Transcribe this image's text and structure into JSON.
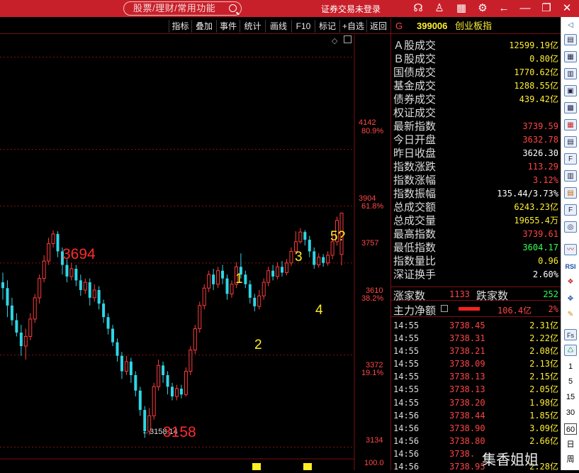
{
  "titlebar": {
    "search_placeholder": "股票/理财/常用功能",
    "login_status": "证券交易未登录",
    "icons": [
      "support-icon",
      "shirt-icon",
      "grid-icon",
      "settings-icon",
      "back-icon",
      "minimize-icon",
      "restore-icon",
      "close-icon"
    ]
  },
  "toolbar": {
    "items": [
      "指标",
      "叠加",
      "事件",
      "统计",
      "画线",
      "F10",
      "标记",
      "+自选",
      "返回"
    ]
  },
  "chart": {
    "price_ticks": [
      {
        "price": "4142",
        "pct": "80.9%"
      },
      {
        "price": "3904",
        "pct": "61.8%"
      },
      {
        "price": "3757",
        "pct": ""
      },
      {
        "price": "3610",
        "pct": "38.2%"
      },
      {
        "price": "3372",
        "pct": "19.1%"
      },
      {
        "price": "3134",
        "pct": ""
      }
    ],
    "volume_tick": "100.0",
    "low_label": "3158.14",
    "annotations": {
      "high": "3694",
      "low": "3158",
      "w1": "1",
      "w2": "2",
      "w3": "3",
      "w4": "4",
      "w5": "5?"
    },
    "colors": {
      "up": "#ff3b3b",
      "down": "#2fd6e6",
      "wave": "#ffee22",
      "dash": "#8a1010"
    }
  },
  "chart_data": {
    "type": "candlestick",
    "ylim": [
      3100,
      4200
    ],
    "candles": [
      {
        "o": 3560,
        "c": 3545,
        "h": 3585,
        "l": 3515
      },
      {
        "o": 3545,
        "c": 3500,
        "h": 3565,
        "l": 3470
      },
      {
        "o": 3500,
        "c": 3462,
        "h": 3520,
        "l": 3448
      },
      {
        "o": 3462,
        "c": 3430,
        "h": 3480,
        "l": 3420
      },
      {
        "o": 3430,
        "c": 3395,
        "h": 3450,
        "l": 3370
      },
      {
        "o": 3395,
        "c": 3420,
        "h": 3440,
        "l": 3360
      },
      {
        "o": 3420,
        "c": 3465,
        "h": 3480,
        "l": 3410
      },
      {
        "o": 3465,
        "c": 3520,
        "h": 3530,
        "l": 3455
      },
      {
        "o": 3520,
        "c": 3570,
        "h": 3580,
        "l": 3505
      },
      {
        "o": 3570,
        "c": 3615,
        "h": 3630,
        "l": 3560
      },
      {
        "o": 3615,
        "c": 3660,
        "h": 3675,
        "l": 3605
      },
      {
        "o": 3660,
        "c": 3685,
        "h": 3694,
        "l": 3650
      },
      {
        "o": 3685,
        "c": 3640,
        "h": 3692,
        "l": 3625
      },
      {
        "o": 3640,
        "c": 3605,
        "h": 3650,
        "l": 3580
      },
      {
        "o": 3605,
        "c": 3575,
        "h": 3620,
        "l": 3560
      },
      {
        "o": 3575,
        "c": 3595,
        "h": 3610,
        "l": 3565
      },
      {
        "o": 3595,
        "c": 3565,
        "h": 3605,
        "l": 3550
      },
      {
        "o": 3565,
        "c": 3540,
        "h": 3580,
        "l": 3525
      },
      {
        "o": 3540,
        "c": 3560,
        "h": 3570,
        "l": 3530
      },
      {
        "o": 3560,
        "c": 3520,
        "h": 3570,
        "l": 3500
      },
      {
        "o": 3520,
        "c": 3540,
        "h": 3555,
        "l": 3510
      },
      {
        "o": 3540,
        "c": 3505,
        "h": 3550,
        "l": 3490
      },
      {
        "o": 3505,
        "c": 3470,
        "h": 3515,
        "l": 3455
      },
      {
        "o": 3470,
        "c": 3440,
        "h": 3480,
        "l": 3425
      },
      {
        "o": 3440,
        "c": 3405,
        "h": 3450,
        "l": 3395
      },
      {
        "o": 3405,
        "c": 3370,
        "h": 3415,
        "l": 3355
      },
      {
        "o": 3370,
        "c": 3330,
        "h": 3380,
        "l": 3310
      },
      {
        "o": 3330,
        "c": 3355,
        "h": 3370,
        "l": 3320
      },
      {
        "o": 3355,
        "c": 3320,
        "h": 3365,
        "l": 3300
      },
      {
        "o": 3320,
        "c": 3280,
        "h": 3330,
        "l": 3265
      },
      {
        "o": 3280,
        "c": 3230,
        "h": 3290,
        "l": 3215
      },
      {
        "o": 3230,
        "c": 3175,
        "h": 3240,
        "l": 3158
      },
      {
        "o": 3175,
        "c": 3215,
        "h": 3235,
        "l": 3165
      },
      {
        "o": 3215,
        "c": 3290,
        "h": 3300,
        "l": 3205
      },
      {
        "o": 3290,
        "c": 3345,
        "h": 3360,
        "l": 3280
      },
      {
        "o": 3345,
        "c": 3320,
        "h": 3355,
        "l": 3300
      },
      {
        "o": 3320,
        "c": 3290,
        "h": 3330,
        "l": 3270
      },
      {
        "o": 3290,
        "c": 3265,
        "h": 3300,
        "l": 3255
      },
      {
        "o": 3265,
        "c": 3285,
        "h": 3295,
        "l": 3255
      },
      {
        "o": 3285,
        "c": 3270,
        "h": 3295,
        "l": 3260
      },
      {
        "o": 3270,
        "c": 3330,
        "h": 3340,
        "l": 3265
      },
      {
        "o": 3330,
        "c": 3385,
        "h": 3395,
        "l": 3320
      },
      {
        "o": 3385,
        "c": 3440,
        "h": 3450,
        "l": 3375
      },
      {
        "o": 3440,
        "c": 3500,
        "h": 3510,
        "l": 3430
      },
      {
        "o": 3500,
        "c": 3545,
        "h": 3555,
        "l": 3490
      },
      {
        "o": 3545,
        "c": 3580,
        "h": 3590,
        "l": 3535
      },
      {
        "o": 3580,
        "c": 3555,
        "h": 3595,
        "l": 3540
      },
      {
        "o": 3555,
        "c": 3590,
        "h": 3600,
        "l": 3545
      },
      {
        "o": 3590,
        "c": 3570,
        "h": 3605,
        "l": 3555
      },
      {
        "o": 3570,
        "c": 3530,
        "h": 3580,
        "l": 3515
      },
      {
        "o": 3530,
        "c": 3555,
        "h": 3565,
        "l": 3520
      },
      {
        "o": 3555,
        "c": 3600,
        "h": 3612,
        "l": 3545
      },
      {
        "o": 3600,
        "c": 3580,
        "h": 3635,
        "l": 3570
      },
      {
        "o": 3580,
        "c": 3555,
        "h": 3590,
        "l": 3545
      },
      {
        "o": 3555,
        "c": 3520,
        "h": 3565,
        "l": 3505
      },
      {
        "o": 3520,
        "c": 3498,
        "h": 3530,
        "l": 3485
      },
      {
        "o": 3498,
        "c": 3525,
        "h": 3540,
        "l": 3490
      },
      {
        "o": 3525,
        "c": 3560,
        "h": 3570,
        "l": 3515
      },
      {
        "o": 3560,
        "c": 3590,
        "h": 3600,
        "l": 3550
      },
      {
        "o": 3590,
        "c": 3575,
        "h": 3605,
        "l": 3565
      },
      {
        "o": 3575,
        "c": 3600,
        "h": 3612,
        "l": 3568
      },
      {
        "o": 3600,
        "c": 3585,
        "h": 3615,
        "l": 3575
      },
      {
        "o": 3585,
        "c": 3610,
        "h": 3620,
        "l": 3578
      },
      {
        "o": 3610,
        "c": 3640,
        "h": 3650,
        "l": 3602
      },
      {
        "o": 3640,
        "c": 3665,
        "h": 3692,
        "l": 3632
      },
      {
        "o": 3665,
        "c": 3690,
        "h": 3700,
        "l": 3660
      },
      {
        "o": 3690,
        "c": 3670,
        "h": 3695,
        "l": 3655
      },
      {
        "o": 3670,
        "c": 3640,
        "h": 3680,
        "l": 3625
      },
      {
        "o": 3640,
        "c": 3605,
        "h": 3650,
        "l": 3595
      },
      {
        "o": 3605,
        "c": 3625,
        "h": 3635,
        "l": 3598
      },
      {
        "o": 3625,
        "c": 3610,
        "h": 3633,
        "l": 3600
      },
      {
        "o": 3610,
        "c": 3630,
        "h": 3640,
        "l": 3603
      },
      {
        "o": 3630,
        "c": 3665,
        "h": 3680,
        "l": 3620
      },
      {
        "o": 3665,
        "c": 3720,
        "h": 3730,
        "l": 3655
      },
      {
        "o": 3632,
        "c": 3739,
        "h": 3740,
        "l": 3604
      }
    ]
  },
  "panel": {
    "code": "399006",
    "name": "创业板指",
    "g_label": "G",
    "quotes": [
      {
        "label": "Ａ股成交",
        "value": "12599.19亿",
        "color": "#ffee33"
      },
      {
        "label": "Ｂ股成交",
        "value": "0.80亿",
        "color": "#ffee33"
      },
      {
        "label": "国债成交",
        "value": "1770.62亿",
        "color": "#ffee33"
      },
      {
        "label": "基金成交",
        "value": "1288.55亿",
        "color": "#ffee33"
      },
      {
        "label": "债券成交",
        "value": "439.42亿",
        "color": "#ffee33"
      },
      {
        "label": "权证成交",
        "value": "",
        "color": "#ffee33"
      },
      {
        "label": "最新指数",
        "value": "3739.59",
        "color": "#ff4444"
      },
      {
        "label": "今日开盘",
        "value": "3632.78",
        "color": "#ff4444"
      },
      {
        "label": "昨日收盘",
        "value": "3626.30",
        "color": "#ffffff"
      },
      {
        "label": "指数涨跌",
        "value": "113.29",
        "color": "#ff4444"
      },
      {
        "label": "指数涨幅",
        "value": "3.12%",
        "color": "#ff4444"
      },
      {
        "label": "指数振幅",
        "value": "135.44/3.73%",
        "color": "#ffffff"
      },
      {
        "label": "总成交额",
        "value": "6243.23亿",
        "color": "#ffee33"
      },
      {
        "label": "总成交量",
        "value": "19655.4万",
        "color": "#ffee33"
      },
      {
        "label": "最高指数",
        "value": "3739.61",
        "color": "#ff4444"
      },
      {
        "label": "最低指数",
        "value": "3604.17",
        "color": "#33ff55"
      },
      {
        "label": "指数量比",
        "value": "0.96",
        "color": "#ffee33"
      },
      {
        "label": "深证换手",
        "value": "2.60%",
        "color": "#ffffff"
      }
    ],
    "updown": {
      "up_label": "涨家数",
      "up": "1133",
      "down_label": "跌家数",
      "down": "252"
    },
    "main_flow": {
      "label": "主力净额",
      "value": "106.4亿",
      "pct": "2%"
    },
    "ticks": [
      {
        "time": "14:55",
        "price": "3738.45",
        "amount": "2.31亿"
      },
      {
        "time": "14:55",
        "price": "3738.31",
        "amount": "2.22亿"
      },
      {
        "time": "14:55",
        "price": "3738.21",
        "amount": "2.08亿"
      },
      {
        "time": "14:55",
        "price": "3738.09",
        "amount": "2.13亿"
      },
      {
        "time": "14:55",
        "price": "3738.13",
        "amount": "2.15亿"
      },
      {
        "time": "14:55",
        "price": "3738.13",
        "amount": "2.05亿"
      },
      {
        "time": "14:55",
        "price": "3738.20",
        "amount": "1.98亿"
      },
      {
        "time": "14:56",
        "price": "3738.44",
        "amount": "1.85亿"
      },
      {
        "time": "14:56",
        "price": "3738.90",
        "amount": "3.09亿"
      },
      {
        "time": "14:56",
        "price": "3738.80",
        "amount": "2.66亿"
      },
      {
        "time": "14:56",
        "price": "3738.",
        "amount": ""
      },
      {
        "time": "14:56",
        "price": "3738.95",
        "amount": "2.28亿"
      }
    ],
    "watermark": "集香姐姐"
  },
  "sidebar": {
    "numbers": [
      "1",
      "5",
      "15",
      "30",
      "60",
      "日",
      "周"
    ],
    "labels": [
      "RSI",
      "Fs"
    ]
  }
}
